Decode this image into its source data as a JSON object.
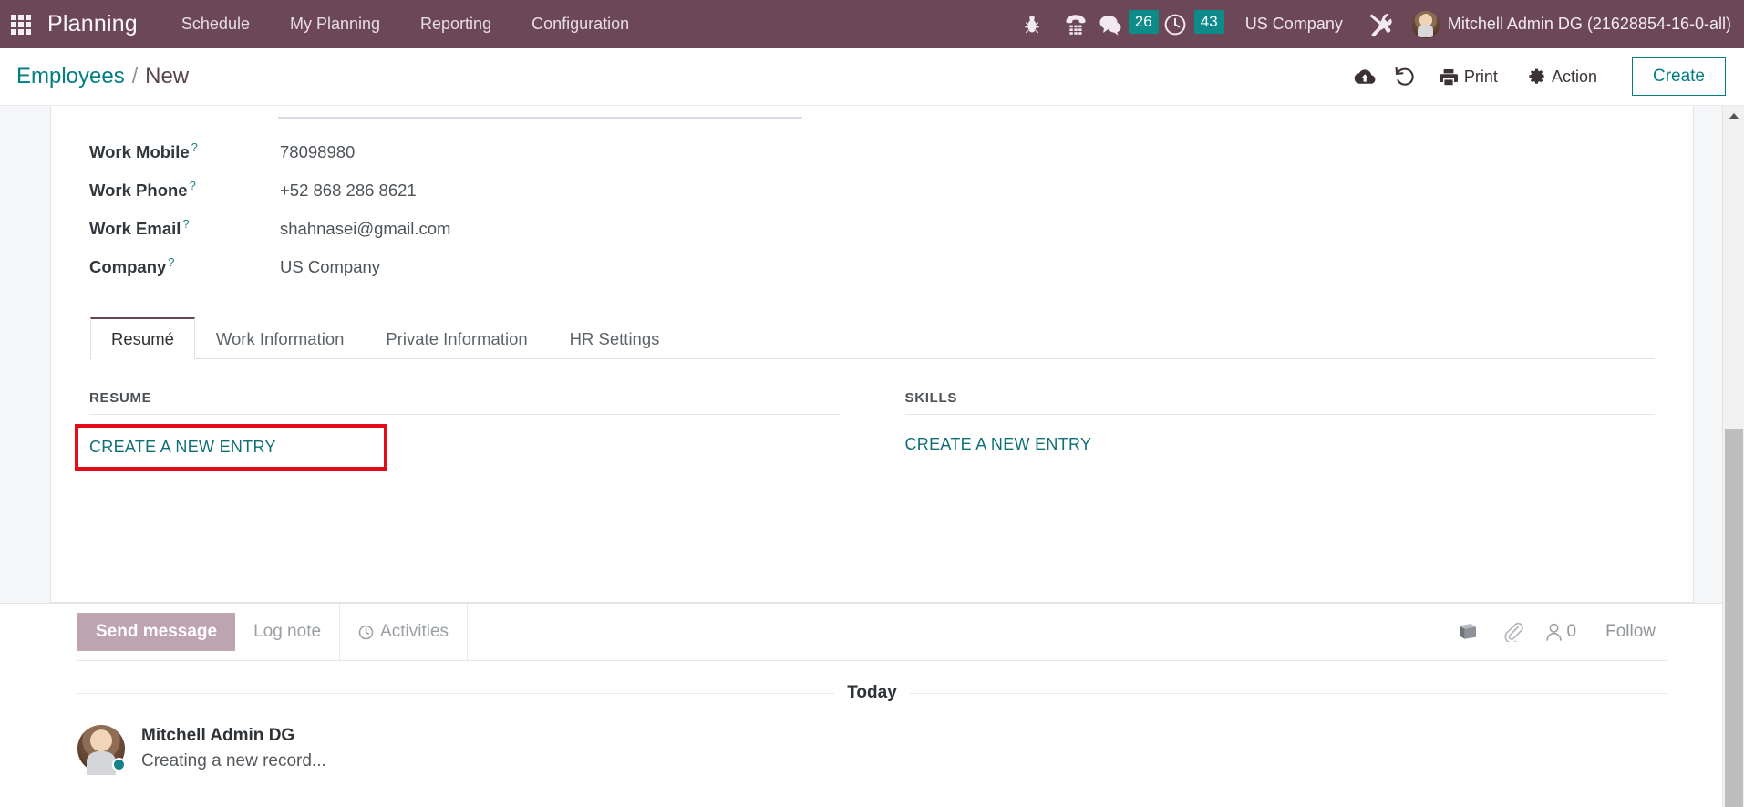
{
  "navbar": {
    "apps_icon": "apps-grid-icon",
    "brand": "Planning",
    "menus": [
      {
        "label": "Schedule"
      },
      {
        "label": "My Planning"
      },
      {
        "label": "Reporting"
      },
      {
        "label": "Configuration"
      }
    ],
    "system_icons": [
      {
        "name": "bug-icon"
      },
      {
        "name": "dialpad-phone-icon"
      }
    ],
    "counters": [
      {
        "name": "messages-counter",
        "icon": "chat-bubble-icon",
        "count": "26"
      },
      {
        "name": "activities-counter",
        "icon": "clock-icon",
        "count": "43"
      }
    ],
    "company": "US Company",
    "tools_icon": "tools-wrench-icon",
    "user": "Mitchell Admin DG (21628854-16-0-all)"
  },
  "control_panel": {
    "breadcrumb_root": "Employees",
    "breadcrumb_sep": "/",
    "breadcrumb_current": "New",
    "save_icon": "cloud-upload-icon",
    "discard_icon": "undo-icon",
    "print_label": "Print",
    "action_label": "Action",
    "create_label": "Create"
  },
  "form": {
    "fields": [
      {
        "label": "Work Mobile",
        "help": "?",
        "value": "78098980"
      },
      {
        "label": "Work Phone",
        "help": "?",
        "value": "+52 868 286 8621"
      },
      {
        "label": "Work Email",
        "help": "?",
        "value": "shahnasei@gmail.com"
      },
      {
        "label": "Company",
        "help": "?",
        "value": "US Company"
      }
    ],
    "tabs": [
      {
        "label": "Resumé",
        "active": true
      },
      {
        "label": "Work Information",
        "active": false
      },
      {
        "label": "Private Information",
        "active": false
      },
      {
        "label": "HR Settings",
        "active": false
      }
    ],
    "resume_section": {
      "title": "RESUME",
      "create_link": "CREATE A NEW ENTRY",
      "highlight_color": "#e60b18"
    },
    "skills_section": {
      "title": "SKILLS",
      "create_link": "CREATE A NEW ENTRY"
    }
  },
  "chatter": {
    "composer_tabs": [
      {
        "label": "Send message",
        "active": true
      },
      {
        "label": "Log note",
        "active": false
      },
      {
        "label": "Activities",
        "active": false,
        "icon": "clock-icon"
      }
    ],
    "tools": [
      {
        "name": "log-book-icon"
      },
      {
        "name": "attachment-paperclip-icon"
      }
    ],
    "followers_icon": "user-icon",
    "followers_count": "0",
    "follow_label": "Follow",
    "thread": {
      "day_label": "Today",
      "messages": [
        {
          "author": "Mitchell Admin DG",
          "text": "Creating a new record..."
        }
      ]
    }
  },
  "scrollbar": {
    "up_arrow": "chevron-up-icon"
  },
  "colors": {
    "navbar_bg": "#6b4757",
    "accent_teal": "#017e84",
    "badge_teal": "#0d8a8a",
    "highlight_red": "#e60b18",
    "composer_active": "#bda4b0"
  }
}
